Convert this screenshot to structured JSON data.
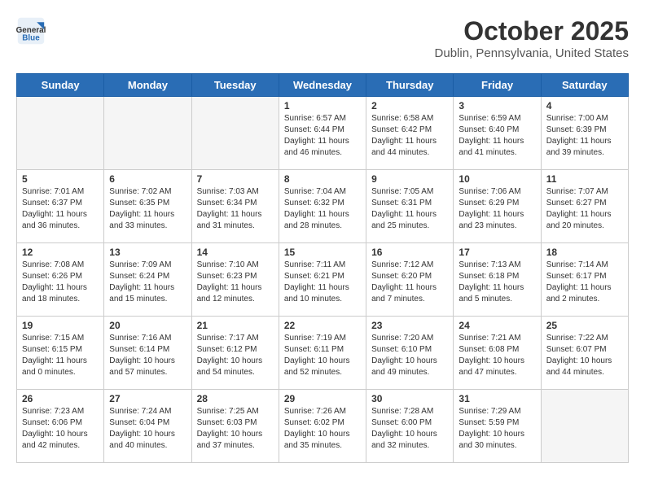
{
  "header": {
    "logo": {
      "general": "General",
      "blue": "Blue"
    },
    "title": "October 2025",
    "location": "Dublin, Pennsylvania, United States"
  },
  "days_of_week": [
    "Sunday",
    "Monday",
    "Tuesday",
    "Wednesday",
    "Thursday",
    "Friday",
    "Saturday"
  ],
  "weeks": [
    [
      {
        "day": "",
        "info": "",
        "empty": true
      },
      {
        "day": "",
        "info": "",
        "empty": true
      },
      {
        "day": "",
        "info": "",
        "empty": true
      },
      {
        "day": "1",
        "info": "Sunrise: 6:57 AM\nSunset: 6:44 PM\nDaylight: 11 hours\nand 46 minutes."
      },
      {
        "day": "2",
        "info": "Sunrise: 6:58 AM\nSunset: 6:42 PM\nDaylight: 11 hours\nand 44 minutes."
      },
      {
        "day": "3",
        "info": "Sunrise: 6:59 AM\nSunset: 6:40 PM\nDaylight: 11 hours\nand 41 minutes."
      },
      {
        "day": "4",
        "info": "Sunrise: 7:00 AM\nSunset: 6:39 PM\nDaylight: 11 hours\nand 39 minutes."
      }
    ],
    [
      {
        "day": "5",
        "info": "Sunrise: 7:01 AM\nSunset: 6:37 PM\nDaylight: 11 hours\nand 36 minutes."
      },
      {
        "day": "6",
        "info": "Sunrise: 7:02 AM\nSunset: 6:35 PM\nDaylight: 11 hours\nand 33 minutes."
      },
      {
        "day": "7",
        "info": "Sunrise: 7:03 AM\nSunset: 6:34 PM\nDaylight: 11 hours\nand 31 minutes."
      },
      {
        "day": "8",
        "info": "Sunrise: 7:04 AM\nSunset: 6:32 PM\nDaylight: 11 hours\nand 28 minutes."
      },
      {
        "day": "9",
        "info": "Sunrise: 7:05 AM\nSunset: 6:31 PM\nDaylight: 11 hours\nand 25 minutes."
      },
      {
        "day": "10",
        "info": "Sunrise: 7:06 AM\nSunset: 6:29 PM\nDaylight: 11 hours\nand 23 minutes."
      },
      {
        "day": "11",
        "info": "Sunrise: 7:07 AM\nSunset: 6:27 PM\nDaylight: 11 hours\nand 20 minutes."
      }
    ],
    [
      {
        "day": "12",
        "info": "Sunrise: 7:08 AM\nSunset: 6:26 PM\nDaylight: 11 hours\nand 18 minutes."
      },
      {
        "day": "13",
        "info": "Sunrise: 7:09 AM\nSunset: 6:24 PM\nDaylight: 11 hours\nand 15 minutes."
      },
      {
        "day": "14",
        "info": "Sunrise: 7:10 AM\nSunset: 6:23 PM\nDaylight: 11 hours\nand 12 minutes."
      },
      {
        "day": "15",
        "info": "Sunrise: 7:11 AM\nSunset: 6:21 PM\nDaylight: 11 hours\nand 10 minutes."
      },
      {
        "day": "16",
        "info": "Sunrise: 7:12 AM\nSunset: 6:20 PM\nDaylight: 11 hours\nand 7 minutes."
      },
      {
        "day": "17",
        "info": "Sunrise: 7:13 AM\nSunset: 6:18 PM\nDaylight: 11 hours\nand 5 minutes."
      },
      {
        "day": "18",
        "info": "Sunrise: 7:14 AM\nSunset: 6:17 PM\nDaylight: 11 hours\nand 2 minutes."
      }
    ],
    [
      {
        "day": "19",
        "info": "Sunrise: 7:15 AM\nSunset: 6:15 PM\nDaylight: 11 hours\nand 0 minutes."
      },
      {
        "day": "20",
        "info": "Sunrise: 7:16 AM\nSunset: 6:14 PM\nDaylight: 10 hours\nand 57 minutes."
      },
      {
        "day": "21",
        "info": "Sunrise: 7:17 AM\nSunset: 6:12 PM\nDaylight: 10 hours\nand 54 minutes."
      },
      {
        "day": "22",
        "info": "Sunrise: 7:19 AM\nSunset: 6:11 PM\nDaylight: 10 hours\nand 52 minutes."
      },
      {
        "day": "23",
        "info": "Sunrise: 7:20 AM\nSunset: 6:10 PM\nDaylight: 10 hours\nand 49 minutes."
      },
      {
        "day": "24",
        "info": "Sunrise: 7:21 AM\nSunset: 6:08 PM\nDaylight: 10 hours\nand 47 minutes."
      },
      {
        "day": "25",
        "info": "Sunrise: 7:22 AM\nSunset: 6:07 PM\nDaylight: 10 hours\nand 44 minutes."
      }
    ],
    [
      {
        "day": "26",
        "info": "Sunrise: 7:23 AM\nSunset: 6:06 PM\nDaylight: 10 hours\nand 42 minutes."
      },
      {
        "day": "27",
        "info": "Sunrise: 7:24 AM\nSunset: 6:04 PM\nDaylight: 10 hours\nand 40 minutes."
      },
      {
        "day": "28",
        "info": "Sunrise: 7:25 AM\nSunset: 6:03 PM\nDaylight: 10 hours\nand 37 minutes."
      },
      {
        "day": "29",
        "info": "Sunrise: 7:26 AM\nSunset: 6:02 PM\nDaylight: 10 hours\nand 35 minutes."
      },
      {
        "day": "30",
        "info": "Sunrise: 7:28 AM\nSunset: 6:00 PM\nDaylight: 10 hours\nand 32 minutes."
      },
      {
        "day": "31",
        "info": "Sunrise: 7:29 AM\nSunset: 5:59 PM\nDaylight: 10 hours\nand 30 minutes."
      },
      {
        "day": "",
        "info": "",
        "empty": true
      }
    ]
  ]
}
